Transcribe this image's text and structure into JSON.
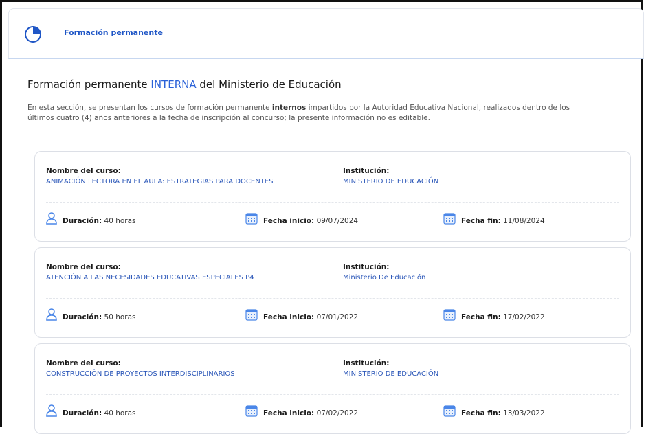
{
  "header": {
    "title": "Formación permanente",
    "icon": "pie-chart-icon"
  },
  "section": {
    "title_prefix": "Formación permanente ",
    "title_accent": "INTERNA",
    "title_suffix": " del Ministerio de Educación",
    "desc_line1_a": "En esta sección, se presentan los cursos de formación permanente ",
    "desc_line1_bold": "internos",
    "desc_line1_b": " impartidos por la Autoridad Educativa Nacional, realizados dentro de los",
    "desc_line2": "últimos cuatro (4) años anteriores a la fecha de inscripción al concurso; la presente información no es editable."
  },
  "labels": {
    "course": "Nombre del curso:",
    "institution": "Institución:",
    "duration": "Duración:",
    "start": "Fecha inicio:",
    "end": "Fecha fin:"
  },
  "courses": [
    {
      "name": "ANIMACIÓN LECTORA EN EL AULA: ESTRATEGIAS PARA DOCENTES",
      "institution": "MINISTERIO DE EDUCACIÓN",
      "duration": "40 horas",
      "start": "09/07/2024",
      "end": "11/08/2024"
    },
    {
      "name": "ATENCIÓN A LAS NECESIDADES EDUCATIVAS ESPECIALES P4",
      "institution": "Ministerio De Educación",
      "duration": "50 horas",
      "start": "07/01/2022",
      "end": "17/02/2022"
    },
    {
      "name": "CONSTRUCCIÓN DE PROYECTOS INTERDISCIPLINARIOS",
      "institution": "MINISTERIO DE EDUCACIÓN",
      "duration": "40 horas",
      "start": "07/02/2022",
      "end": "13/03/2022"
    }
  ],
  "colors": {
    "accent": "#2b62d8",
    "link": "#2a56b8",
    "icon": "#4a86e8"
  }
}
